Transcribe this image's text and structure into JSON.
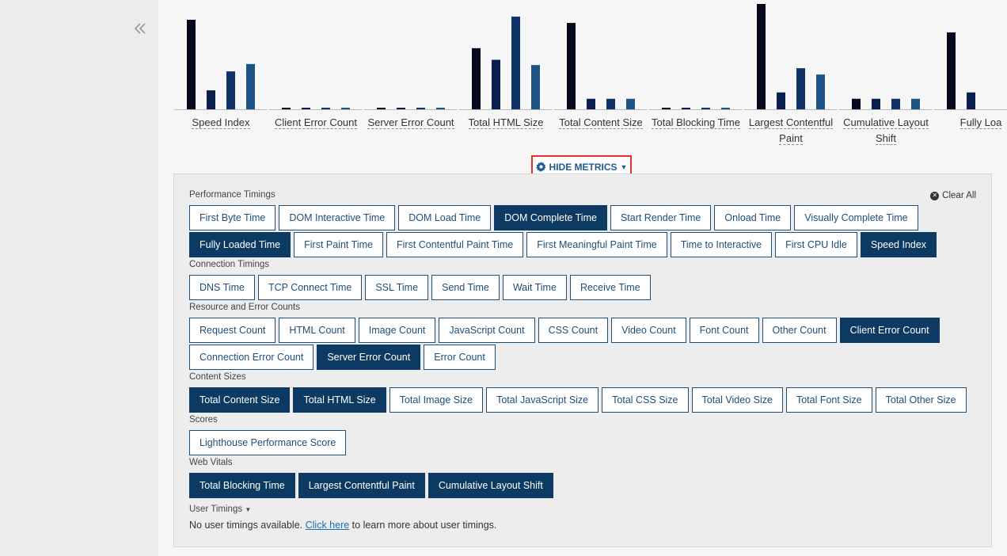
{
  "sidebar": {
    "collapse_icon": "double-chevron-left-icon"
  },
  "chart_data": {
    "type": "bar",
    "categories": [
      "Speed Index",
      "Client Error Count",
      "Server Error Count",
      "Total HTML Size",
      "Total Content Size",
      "Total Blocking Time",
      "Largest Contentful Paint",
      "Cumulative Layout Shift",
      "Fully Loaded Time"
    ],
    "category_labels": [
      "Speed Index",
      "Client Error Count",
      "Server Error Count",
      "Total HTML Size",
      "Total Content Size",
      "Total Blocking Time",
      "Largest Contentful Paint",
      "Cumulative Layout Shift",
      "Fully Loa"
    ],
    "series": [
      {
        "values": [
          0.85,
          0.015,
          0.015,
          0.58,
          0.82,
          0.015,
          1.0,
          0.1,
          0.73
        ],
        "color": "#050a1f"
      },
      {
        "values": [
          0.18,
          0.015,
          0.015,
          0.47,
          0.1,
          0.015,
          0.16,
          0.1,
          0.16
        ],
        "color": "#0a1f4d"
      },
      {
        "values": [
          0.36,
          0.015,
          0.015,
          0.88,
          0.1,
          0.015,
          0.39,
          0.1,
          0.0
        ],
        "color": "#0f3366"
      },
      {
        "values": [
          0.43,
          0.015,
          0.015,
          0.42,
          0.1,
          0.015,
          0.33,
          0.1,
          0.0
        ],
        "color": "#1c5485"
      }
    ],
    "ylim": [
      0,
      1
    ],
    "xlabel": "",
    "ylabel": "",
    "grid": false,
    "legend": "none"
  },
  "toggle": {
    "label": "HIDE METRICS",
    "icon": "gear-icon"
  },
  "clear_all": {
    "label": "Clear All",
    "icon": "close-circle-icon"
  },
  "groups": [
    {
      "label": "Performance Timings",
      "rows": [
        [
          {
            "label": "First Byte Time",
            "on": false
          },
          {
            "label": "DOM Interactive Time",
            "on": false
          },
          {
            "label": "DOM Load Time",
            "on": false
          },
          {
            "label": "DOM Complete Time",
            "on": true
          },
          {
            "label": "Start Render Time",
            "on": false
          },
          {
            "label": "Onload Time",
            "on": false
          },
          {
            "label": "Visually Complete Time",
            "on": false
          }
        ],
        [
          {
            "label": "Fully Loaded Time",
            "on": true
          },
          {
            "label": "First Paint Time",
            "on": false
          },
          {
            "label": "First Contentful Paint Time",
            "on": false
          },
          {
            "label": "First Meaningful Paint Time",
            "on": false
          },
          {
            "label": "Time to Interactive",
            "on": false
          },
          {
            "label": "First CPU Idle",
            "on": false
          },
          {
            "label": "Speed Index",
            "on": true
          }
        ]
      ]
    },
    {
      "label": "Connection Timings",
      "rows": [
        [
          {
            "label": "DNS Time",
            "on": false
          },
          {
            "label": "TCP Connect Time",
            "on": false
          },
          {
            "label": "SSL Time",
            "on": false
          },
          {
            "label": "Send Time",
            "on": false
          },
          {
            "label": "Wait Time",
            "on": false
          },
          {
            "label": "Receive Time",
            "on": false
          }
        ]
      ]
    },
    {
      "label": "Resource and Error Counts",
      "rows": [
        [
          {
            "label": "Request Count",
            "on": false
          },
          {
            "label": "HTML Count",
            "on": false
          },
          {
            "label": "Image Count",
            "on": false
          },
          {
            "label": "JavaScript Count",
            "on": false
          },
          {
            "label": "CSS Count",
            "on": false
          },
          {
            "label": "Video Count",
            "on": false
          },
          {
            "label": "Font Count",
            "on": false
          },
          {
            "label": "Other Count",
            "on": false
          },
          {
            "label": "Client Error Count",
            "on": true
          }
        ],
        [
          {
            "label": "Connection Error Count",
            "on": false
          },
          {
            "label": "Server Error Count",
            "on": true
          },
          {
            "label": "Error Count",
            "on": false
          }
        ]
      ]
    },
    {
      "label": "Content Sizes",
      "rows": [
        [
          {
            "label": "Total Content Size",
            "on": true
          },
          {
            "label": "Total HTML Size",
            "on": true
          },
          {
            "label": "Total Image Size",
            "on": false
          },
          {
            "label": "Total JavaScript Size",
            "on": false
          },
          {
            "label": "Total CSS Size",
            "on": false
          },
          {
            "label": "Total Video Size",
            "on": false
          },
          {
            "label": "Total Font Size",
            "on": false
          },
          {
            "label": "Total Other Size",
            "on": false
          }
        ]
      ]
    },
    {
      "label": "Scores",
      "rows": [
        [
          {
            "label": "Lighthouse Performance Score",
            "on": false
          }
        ]
      ]
    },
    {
      "label": "Web Vitals",
      "rows": [
        [
          {
            "label": "Total Blocking Time",
            "on": true
          },
          {
            "label": "Largest Contentful Paint",
            "on": true
          },
          {
            "label": "Cumulative Layout Shift",
            "on": true
          }
        ]
      ]
    }
  ],
  "user_timings": {
    "label": "User Timings",
    "caret_icon": "caret-down-icon",
    "note_prefix": "No user timings available.",
    "link_text": "Click here",
    "note_suffix": "to learn more about user timings."
  }
}
